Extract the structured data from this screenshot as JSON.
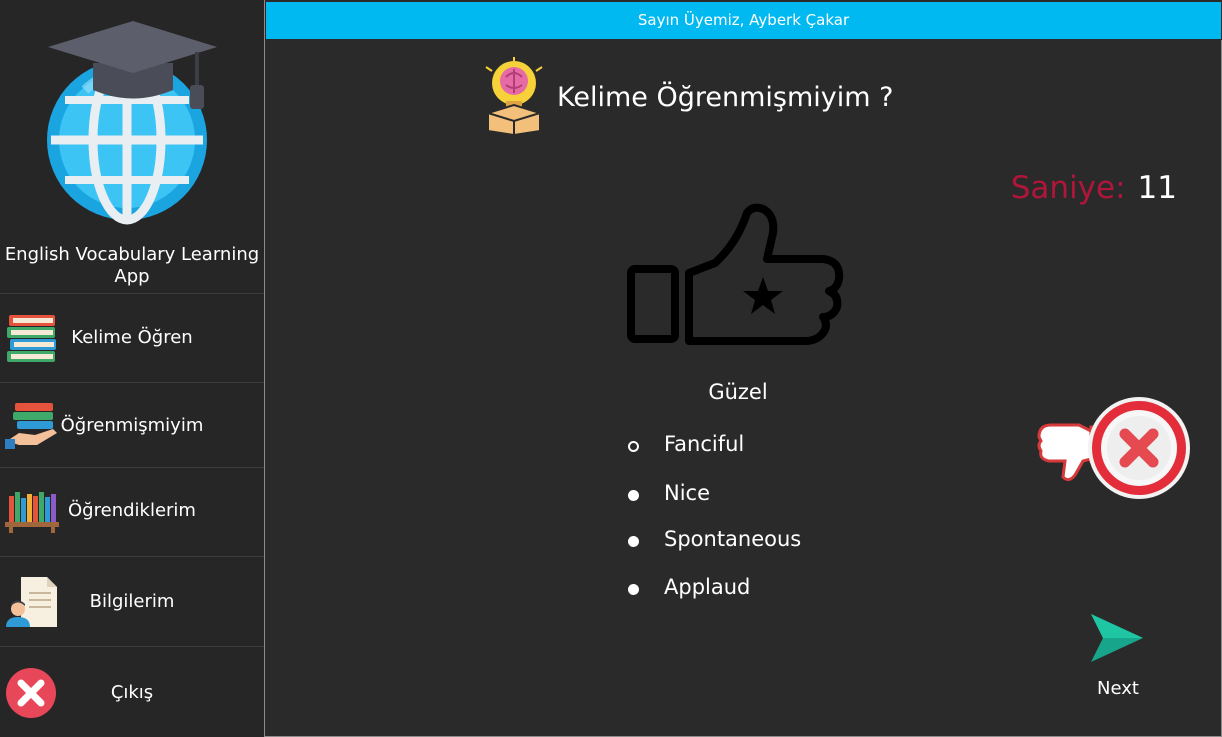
{
  "app": {
    "title": "English Vocabulary Learning App"
  },
  "sidebar": {
    "items": [
      {
        "label": "Kelime Öğren",
        "icon": "books-stack-icon"
      },
      {
        "label": "Öğrenmişmiyim",
        "icon": "books-hand-icon"
      },
      {
        "label": "Öğrendiklerim",
        "icon": "bookshelf-icon"
      },
      {
        "label": "Bilgilerim",
        "icon": "user-document-icon"
      },
      {
        "label": "Çıkış",
        "icon": "exit-x-icon"
      }
    ]
  },
  "header": {
    "greeting": "Sayın Üyemiz, Ayberk Çakar"
  },
  "quiz": {
    "title": "Kelime Öğrenmişmiyim ?",
    "title_icon": "brain-bulb-box-icon",
    "timer_label": "Saniye:",
    "timer_value": "11",
    "word": "Güzel",
    "options": [
      {
        "label": "Fanciful",
        "selected": true
      },
      {
        "label": "Nice",
        "selected": false
      },
      {
        "label": "Spontaneous",
        "selected": false
      },
      {
        "label": "Applaud",
        "selected": false
      }
    ],
    "result_icon": "thumbs-down-wrong-icon",
    "next_label": "Next"
  },
  "colors": {
    "accent_bar": "#00b9f1",
    "background": "#2a2a2a",
    "sidebar": "#262626",
    "timer_label": "#b0153a",
    "next_arrow": "#17a68b",
    "wrong": "#e32d3a"
  }
}
